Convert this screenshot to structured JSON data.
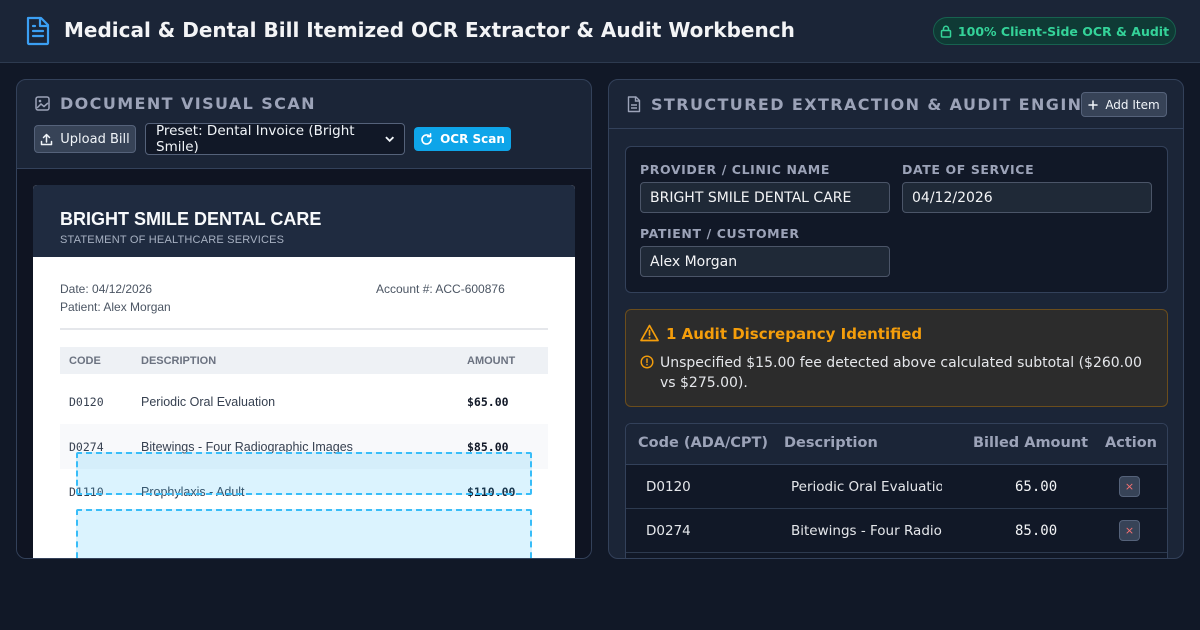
{
  "header": {
    "title": "Medical & Dental Bill Itemized OCR Extractor & Audit Workbench",
    "badge": "100% Client-Side OCR & Audit"
  },
  "left_panel": {
    "title": "DOCUMENT VISUAL SCAN",
    "upload_label": "Upload Bill",
    "preset_selected": "Preset: Dental Invoice (Bright Smile)",
    "ocr_label": "OCR Scan"
  },
  "document": {
    "clinic": "BRIGHT SMILE DENTAL CARE",
    "subtitle": "STATEMENT OF HEALTHCARE SERVICES",
    "date": "Date: 04/12/2026",
    "patient": "Patient: Alex Morgan",
    "account": "Account #: ACC-600876",
    "columns": [
      "CODE",
      "DESCRIPTION",
      "AMOUNT"
    ],
    "rows": [
      {
        "code": "D0120",
        "description": "Periodic Oral Evaluation",
        "amount": "$65.00"
      },
      {
        "code": "D0274",
        "description": "Bitewings - Four Radiographic Images",
        "amount": "$85.00"
      },
      {
        "code": "D1110",
        "description": "Prophylaxis - Adult",
        "amount": "$110.00"
      }
    ]
  },
  "right_panel": {
    "title": "STRUCTURED EXTRACTION & AUDIT ENGINE",
    "add_label": "Add Item",
    "provider_label": "PROVIDER / CLINIC NAME",
    "provider_value": "BRIGHT SMILE DENTAL CARE",
    "date_label": "DATE OF SERVICE",
    "date_value": "04/12/2026",
    "patient_label": "PATIENT / CUSTOMER",
    "patient_value": "Alex Morgan"
  },
  "audit": {
    "title": "1 Audit Discrepancy Identified",
    "message": "Unspecified $15.00 fee detected above calculated subtotal ($260.00 vs $275.00)."
  },
  "items_table": {
    "columns": [
      "Code (ADA/CPT)",
      "Description",
      "Billed Amount",
      "Action"
    ],
    "rows": [
      {
        "code": "D0120",
        "description": "Periodic Oral Evaluation",
        "amount": "65.00",
        "action": "×"
      },
      {
        "code": "D0274",
        "description": "Bitewings - Four Radiographic Images",
        "amount": "85.00",
        "action": "×"
      }
    ]
  },
  "colors": {
    "background": "#111827",
    "panel": "#1b2537",
    "accent": "#0ea5e9",
    "success": "#34d399",
    "warning": "#f59e0b",
    "danger": "#f87171"
  }
}
